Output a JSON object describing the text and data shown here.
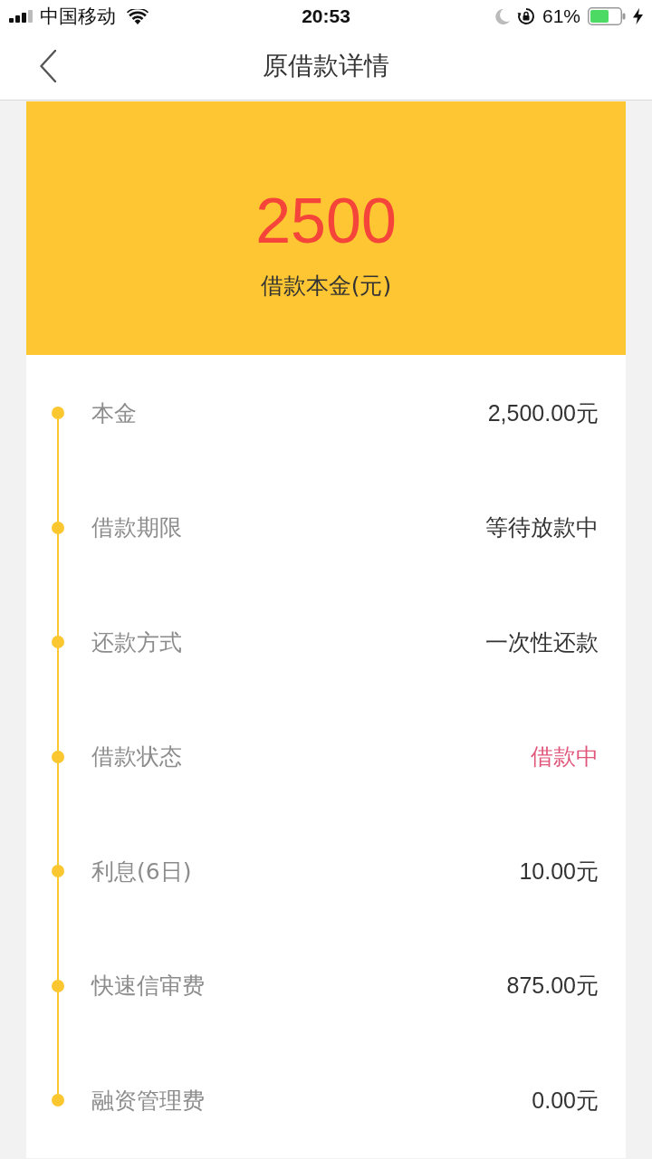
{
  "status_bar": {
    "carrier": "中国移动",
    "time": "20:53",
    "battery_text": "61%"
  },
  "nav": {
    "title": "原借款详情"
  },
  "summary": {
    "amount": "2500",
    "label": "借款本金(元)"
  },
  "details": [
    {
      "label": "本金",
      "value": "2,500.00元",
      "highlighted": false
    },
    {
      "label": "借款期限",
      "value": "等待放款中",
      "highlighted": false
    },
    {
      "label": "还款方式",
      "value": "一次性还款",
      "highlighted": false
    },
    {
      "label": "借款状态",
      "value": "借款中",
      "highlighted": true
    },
    {
      "label": "利息(6日)",
      "value": "10.00元",
      "highlighted": false
    },
    {
      "label": "快速信审费",
      "value": "875.00元",
      "highlighted": false
    },
    {
      "label": "融资管理费",
      "value": "0.00元",
      "highlighted": false
    }
  ]
}
